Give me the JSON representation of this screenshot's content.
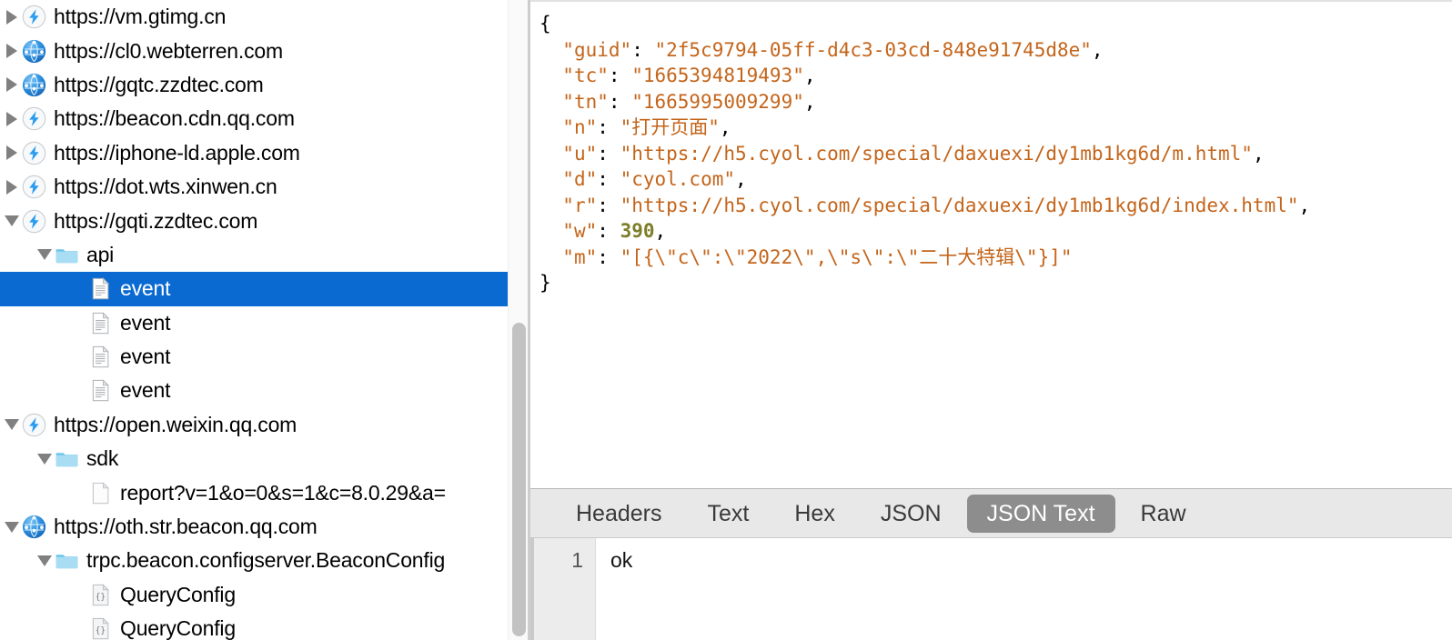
{
  "tree": {
    "rows": [
      {
        "label": "https://vm.gtimg.cn",
        "icon": "lightning-bolt-icon",
        "twisty": "right",
        "indent": 0,
        "selected": false
      },
      {
        "label": "https://cl0.webterren.com",
        "icon": "globe-network-icon",
        "twisty": "right",
        "indent": 0,
        "selected": false
      },
      {
        "label": "https://gqtc.zzdtec.com",
        "icon": "globe-network-icon",
        "twisty": "right",
        "indent": 0,
        "selected": false
      },
      {
        "label": "https://beacon.cdn.qq.com",
        "icon": "lightning-bolt-icon",
        "twisty": "right",
        "indent": 0,
        "selected": false
      },
      {
        "label": "https://iphone-ld.apple.com",
        "icon": "lightning-bolt-icon",
        "twisty": "right",
        "indent": 0,
        "selected": false
      },
      {
        "label": "https://dot.wts.xinwen.cn",
        "icon": "lightning-bolt-icon",
        "twisty": "right",
        "indent": 0,
        "selected": false
      },
      {
        "label": "https://gqti.zzdtec.com",
        "icon": "lightning-bolt-icon",
        "twisty": "down",
        "indent": 0,
        "selected": false
      },
      {
        "label": "api",
        "icon": "folder-icon",
        "twisty": "down",
        "indent": 1,
        "selected": false
      },
      {
        "label": "event",
        "icon": "document-icon",
        "twisty": "none",
        "indent": 2,
        "selected": true
      },
      {
        "label": "event",
        "icon": "document-icon",
        "twisty": "none",
        "indent": 2,
        "selected": false
      },
      {
        "label": "event",
        "icon": "document-icon",
        "twisty": "none",
        "indent": 2,
        "selected": false
      },
      {
        "label": "event",
        "icon": "document-icon",
        "twisty": "none",
        "indent": 2,
        "selected": false
      },
      {
        "label": "https://open.weixin.qq.com",
        "icon": "lightning-bolt-icon",
        "twisty": "down",
        "indent": 0,
        "selected": false
      },
      {
        "label": "sdk",
        "icon": "folder-icon",
        "twisty": "down",
        "indent": 1,
        "selected": false
      },
      {
        "label": "report?v=1&o=0&s=1&c=8.0.29&a=",
        "icon": "blank-page-icon",
        "twisty": "none",
        "indent": 2,
        "selected": false
      },
      {
        "label": "https://oth.str.beacon.qq.com",
        "icon": "globe-network-icon",
        "twisty": "down",
        "indent": 0,
        "selected": false
      },
      {
        "label": "trpc.beacon.configserver.BeaconConfig",
        "icon": "folder-icon",
        "twisty": "down",
        "indent": 1,
        "selected": false
      },
      {
        "label": "QueryConfig",
        "icon": "json-page-icon",
        "twisty": "none",
        "indent": 2,
        "selected": false
      },
      {
        "label": "QueryConfig",
        "icon": "json-page-icon",
        "twisty": "none",
        "indent": 2,
        "selected": false
      }
    ]
  },
  "json_viewer": {
    "lines": [
      {
        "indent": 0,
        "brace": "{"
      },
      {
        "indent": 1,
        "key": "guid",
        "value": "\"2f5c9794-05ff-d4c3-03cd-848e91745d8e\"",
        "type": "string",
        "comma": true
      },
      {
        "indent": 1,
        "key": "tc",
        "value": "\"1665394819493\"",
        "type": "string",
        "comma": true
      },
      {
        "indent": 1,
        "key": "tn",
        "value": "\"1665995009299\"",
        "type": "string",
        "comma": true
      },
      {
        "indent": 1,
        "key": "n",
        "value": "\"打开页面\"",
        "type": "string",
        "comma": true
      },
      {
        "indent": 1,
        "key": "u",
        "value": "\"https://h5.cyol.com/special/daxuexi/dy1mb1kg6d/m.html\"",
        "type": "string",
        "comma": true
      },
      {
        "indent": 1,
        "key": "d",
        "value": "\"cyol.com\"",
        "type": "string",
        "comma": true
      },
      {
        "indent": 1,
        "key": "r",
        "value": "\"https://h5.cyol.com/special/daxuexi/dy1mb1kg6d/index.html\"",
        "type": "string",
        "comma": true
      },
      {
        "indent": 1,
        "key": "w",
        "value": "390",
        "type": "number",
        "comma": true
      },
      {
        "indent": 1,
        "key": "m",
        "value": "\"[{\\\"c\\\":\\\"2022\\\",\\\"s\\\":\\\"二十大特辑\\\"}]\"",
        "type": "string",
        "comma": false
      },
      {
        "indent": 0,
        "brace": "}"
      }
    ]
  },
  "tabs": {
    "items": [
      {
        "label": "Headers",
        "active": false
      },
      {
        "label": "Text",
        "active": false
      },
      {
        "label": "Hex",
        "active": false
      },
      {
        "label": "JSON",
        "active": false
      },
      {
        "label": "JSON Text",
        "active": true
      },
      {
        "label": "Raw",
        "active": false
      }
    ]
  },
  "bottom_view": {
    "lines": [
      {
        "number": "1",
        "text": "ok"
      }
    ]
  },
  "colors": {
    "selection_blue": "#0a6ad1",
    "json_string": "#c4651b",
    "json_number": "#7d7d28",
    "active_tab_bg": "#8d8d8d",
    "tab_strip_bg": "#e8e8e8",
    "folder_blue": "#8ed2f0",
    "globe_blue": "#2b8fe0"
  }
}
